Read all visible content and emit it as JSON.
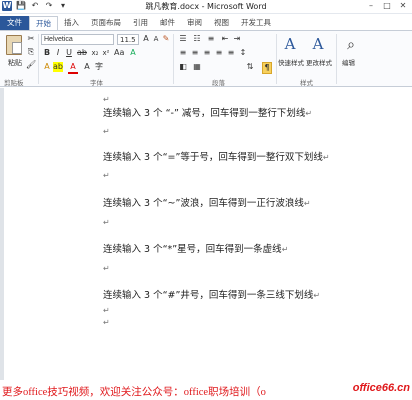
{
  "titlebar": {
    "title": "跳凡教育.docx - Microsoft Word",
    "word_icon": "W",
    "save_icon": "save-icon",
    "undo_icon": "undo-icon",
    "redo_icon": "redo-icon"
  },
  "tabs": [
    {
      "label": "文件"
    },
    {
      "label": "开始"
    },
    {
      "label": "插入"
    },
    {
      "label": "页面布局"
    },
    {
      "label": "引用"
    },
    {
      "label": "邮件"
    },
    {
      "label": "审阅"
    },
    {
      "label": "视图"
    },
    {
      "label": "开发工具"
    }
  ],
  "ribbon": {
    "clipboard": {
      "paste_label": "粘贴",
      "group_label": "剪贴板"
    },
    "font": {
      "font_name": "Helvetica",
      "font_size": "11.5",
      "group_label": "字体"
    },
    "paragraph": {
      "group_label": "段落"
    },
    "styles": {
      "quick_label": "快速样式",
      "change_label": "更改样式",
      "group_label": "样式"
    },
    "editing": {
      "label": "编辑"
    }
  },
  "document": {
    "lines": [
      "连续输入 3 个 “-” 减号，回车得到一整行下划线",
      "连续输入 3 个“=”等于号，回车得到一整行双下划线",
      "连续输入 3 个“~”波浪，回车得到一正行波浪线",
      "连续输入 3 个“*”星号，回车得到一条虚线",
      "连续输入 3 个“#”井号，回车得到一条三线下划线"
    ],
    "para_mark": "↵"
  },
  "banner": {
    "text": "更多office技巧视频，欢迎关注公众号：office职场培训（o",
    "logo": "office66.cn"
  }
}
